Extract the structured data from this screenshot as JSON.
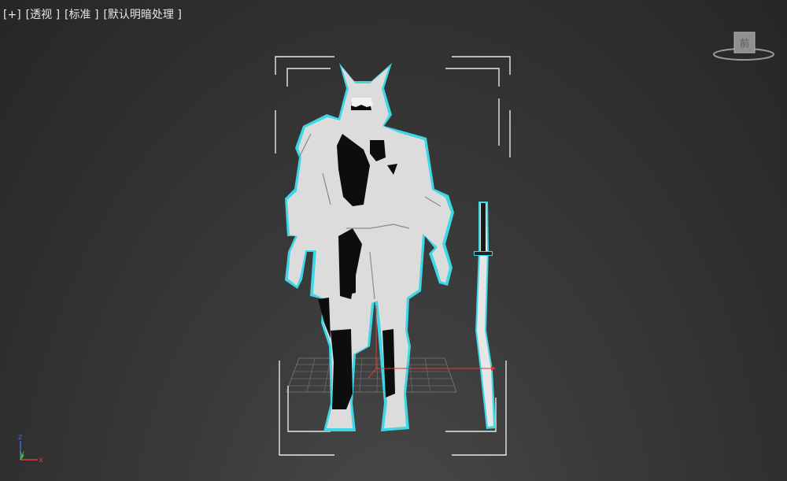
{
  "viewport": {
    "labels": {
      "plus": "[+]",
      "view": "[透视 ]",
      "camera": "[标准 ]",
      "shading": "[默认明暗处理 ]"
    }
  },
  "viewcube": {
    "face_label": "前"
  },
  "axis": {
    "z": "z",
    "y": "y",
    "x": "x"
  },
  "colors": {
    "background": "#2e2e2e",
    "selection_outline": "#3fd6e6",
    "bounding_box": "#e8e8e8",
    "grid": "#6a6a6a",
    "axis_x": "#e03a3a",
    "axis_y": "#3ad23a",
    "axis_z": "#3a6ae0"
  }
}
